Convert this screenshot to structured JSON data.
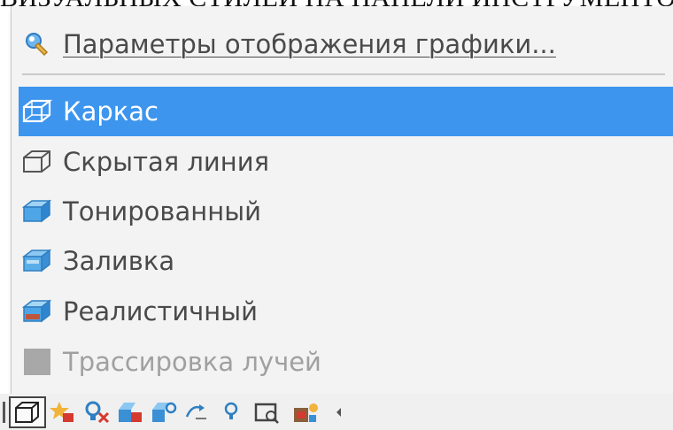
{
  "top_partial_text": "ВИЗУАЛЬНЫХ СТИЛЕЙ НА ПАНЕЛИ ИНСТРУМЕНТОВ УСТАНОВКИ",
  "menu": {
    "settings_item": {
      "label": "Параметры отображения графики...",
      "icon": "display-settings-icon"
    },
    "styles": [
      {
        "label": "Каркас",
        "icon": "wireframe-cube-icon",
        "selected": true
      },
      {
        "label": "Скрытая линия",
        "icon": "hidden-line-cube-icon"
      },
      {
        "label": "Тонированный",
        "icon": "shaded-cube-icon"
      },
      {
        "label": "Заливка",
        "icon": "flat-fill-cube-icon"
      },
      {
        "label": "Реалистичный",
        "icon": "realistic-cube-icon"
      },
      {
        "label": "Трассировка лучей",
        "icon": "ray-tracing-icon",
        "disabled": true
      }
    ]
  },
  "colors": {
    "selection": "#3d95ee",
    "menu_bg": "#f3f3f3",
    "disabled_text": "#a0a0a0"
  },
  "toolbar": {
    "buttons": [
      "visual-style-cube-icon",
      "render-star-icon",
      "light-delete-icon",
      "light-edit-icon",
      "sun-icon",
      "camera-icon",
      "light-bulb-icon",
      "render-window-icon",
      "materials-icon",
      "overflow-arrow-icon"
    ]
  }
}
